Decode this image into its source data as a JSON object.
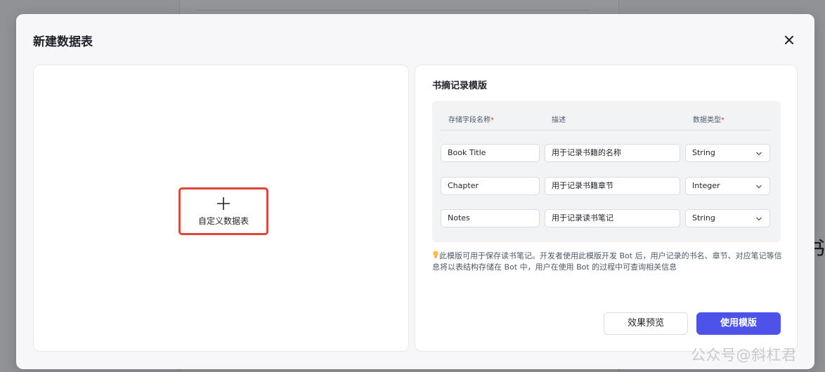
{
  "background": {
    "right_glyph": "书"
  },
  "modal": {
    "title": "新建数据表",
    "close_icon": "close-icon"
  },
  "custom_table": {
    "icon": "plus-icon",
    "label": "自定义数据表"
  },
  "template": {
    "title": "书摘记录模版",
    "columns": {
      "name": "存储字段名称",
      "description": "描述",
      "type": "数据类型",
      "required_mark": "*"
    },
    "rows": [
      {
        "name": "Book Title",
        "description": "用于记录书籍的名称",
        "type": "String"
      },
      {
        "name": "Chapter",
        "description": "用于记录书籍章节",
        "type": "Integer"
      },
      {
        "name": "Notes",
        "description": "用于记录读书笔记",
        "type": "String"
      }
    ],
    "hint": "此模版可用于保存读书笔记。开发者使用此模版开发 Bot 后，用户记录的书名、章节、对应笔记等信息将以表结构存储在 Bot 中，用户在使用 Bot 的过程中可查询相关信息",
    "hint_icon": "lightbulb-icon",
    "preview_button": "效果预览",
    "use_button": "使用模版"
  },
  "watermark": "公众号@斜杠君",
  "colors": {
    "primary": "#4d53e8",
    "highlight": "#e0453a",
    "required": "#e0453a"
  }
}
